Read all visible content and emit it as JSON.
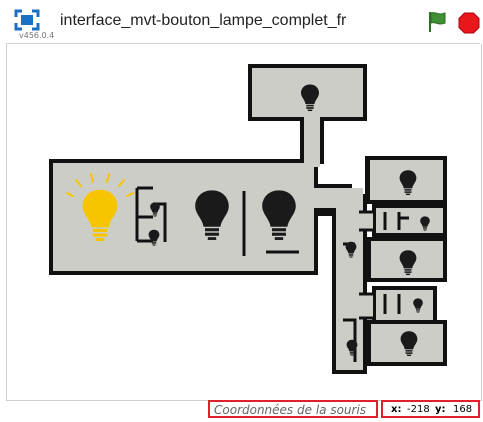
{
  "window": {
    "title": "interface_mvt-bouton_lampe_complet_fr",
    "version": "v456.0.4"
  },
  "controls": {
    "green_flag_icon": "green-flag",
    "stop_icon": "stop-sign",
    "flag_color": "#3f8f34",
    "stop_color": "#e8171c"
  },
  "stage": {
    "wall_color": "#111111",
    "room_color": "#cdcdc8",
    "lit_bulb_color": "#f7c500",
    "unlit_bulb_color": "#1a1a1a"
  },
  "mouse_coords": {
    "label": "Coordonnées de la souris",
    "x_label": "x:",
    "x_value": "-218",
    "y_label": "y:",
    "y_value": "168"
  }
}
